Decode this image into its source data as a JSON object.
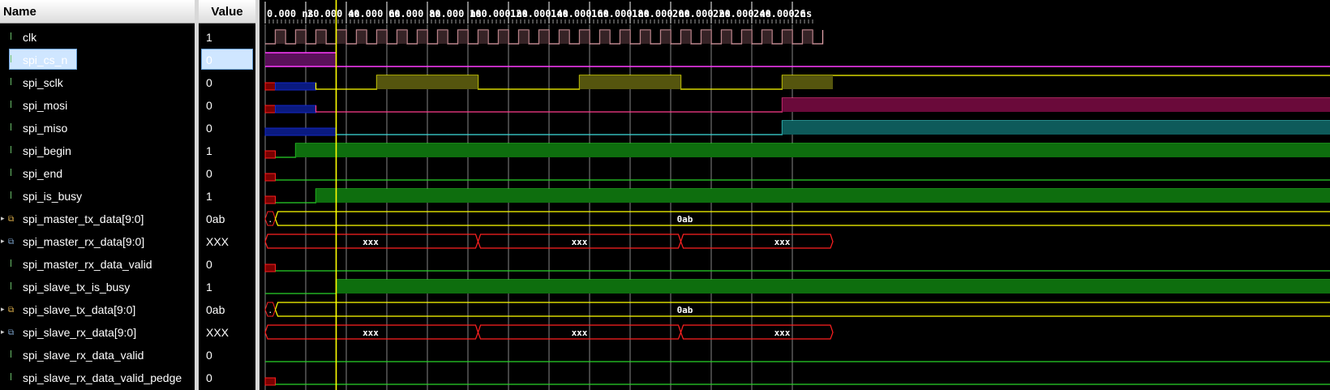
{
  "headers": {
    "name": "Name",
    "value": "Value"
  },
  "colors": {
    "clk": "#e0a0a8",
    "cs": "#ff3cff",
    "csfill": "#5a105a",
    "yellow": "#ffff00",
    "yfill": "#55550e",
    "blue": "#1428c8",
    "bfill": "#0a1a80",
    "green": "#28d228",
    "gfill": "#0e6e0e",
    "red": "#ff2020",
    "rfill": "#7a0000",
    "pink": "#ff3c8c",
    "cyan": "#3cdcdc",
    "cursor": "#ffff00",
    "grid": "#bfbfbf"
  },
  "signals": [
    {
      "name": "clk",
      "value": "1",
      "icon": "scalar-signal-icon"
    },
    {
      "name": "spi_cs_n",
      "value": "0",
      "icon": "scalar-signal-icon",
      "selected": true
    },
    {
      "name": "spi_sclk",
      "value": "0",
      "icon": "scalar-signal-icon"
    },
    {
      "name": "spi_mosi",
      "value": "0",
      "icon": "scalar-signal-icon"
    },
    {
      "name": "spi_miso",
      "value": "0",
      "icon": "scalar-signal-icon"
    },
    {
      "name": "spi_begin",
      "value": "1",
      "icon": "scalar-signal-icon"
    },
    {
      "name": "spi_end",
      "value": "0",
      "icon": "scalar-signal-icon"
    },
    {
      "name": "spi_is_busy",
      "value": "1",
      "icon": "scalar-signal-icon"
    },
    {
      "name": "spi_master_tx_data[9:0]",
      "value": "0ab",
      "icon": "bus-signal-icon",
      "bus": true
    },
    {
      "name": "spi_master_rx_data[9:0]",
      "value": "XXX",
      "icon": "bus-signal-icon",
      "bus": true
    },
    {
      "name": "spi_master_rx_data_valid",
      "value": "0",
      "icon": "scalar-signal-icon"
    },
    {
      "name": "spi_slave_tx_is_busy",
      "value": "1",
      "icon": "scalar-signal-icon"
    },
    {
      "name": "spi_slave_tx_data[9:0]",
      "value": "0ab",
      "icon": "bus-signal-icon",
      "bus": true
    },
    {
      "name": "spi_slave_rx_data[9:0]",
      "value": "XXX",
      "icon": "bus-signal-icon",
      "bus": true
    },
    {
      "name": "spi_slave_rx_data_valid",
      "value": "0",
      "icon": "scalar-signal-icon"
    },
    {
      "name": "spi_slave_rx_data_valid_pedge",
      "value": "0",
      "icon": "scalar-signal-icon"
    }
  ],
  "timeline": {
    "unit": "ns",
    "ticks": [
      "0.000 ns",
      "20.000 ns",
      "40.000 ns",
      "60.000 ns",
      "80.000 ns",
      "100.000 ns",
      "120.000 ns",
      "140.000 ns",
      "160.000 ns",
      "180.000 ns",
      "200.000 ns",
      "220.000 ns",
      "240.000 ns",
      "26"
    ],
    "cursor_ns": 35,
    "clock_period_ns": 10
  },
  "bus_labels": {
    "tx_start": ".",
    "tx_value": "0ab",
    "rx_value": "xxx"
  }
}
